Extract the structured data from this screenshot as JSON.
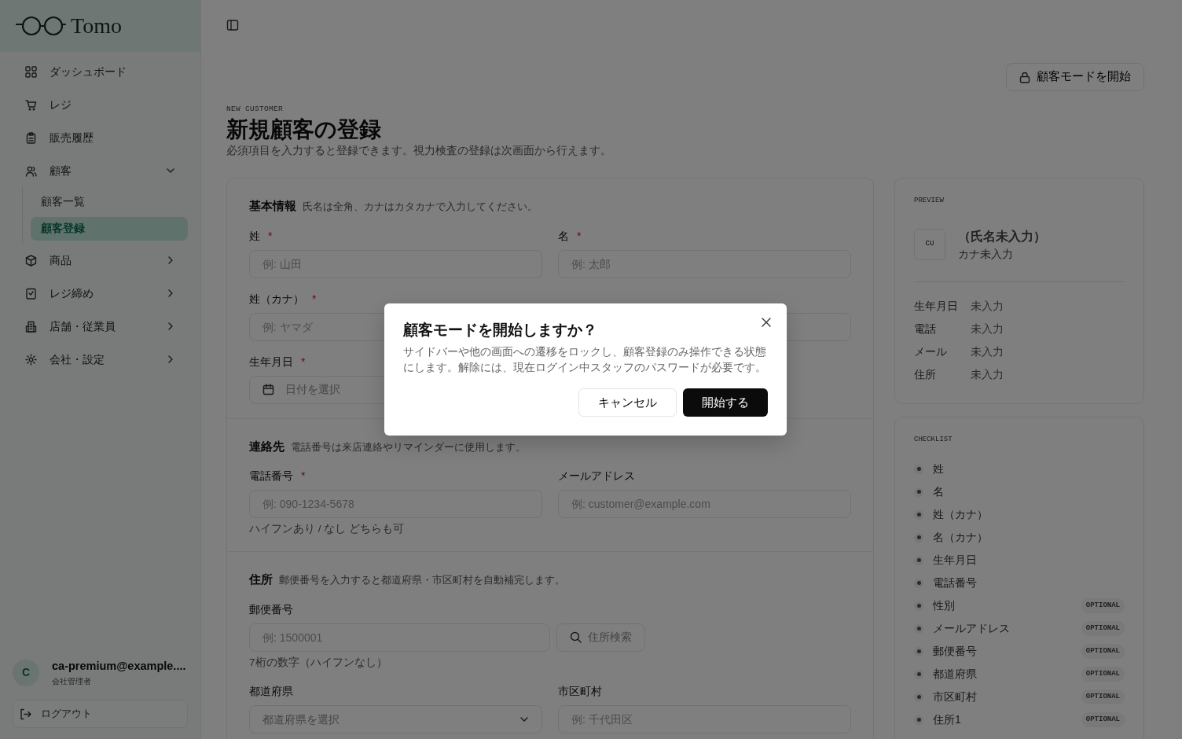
{
  "sidebar": {
    "logo": "Tomo",
    "nav": [
      {
        "label": "ダッシュボード"
      },
      {
        "label": "レジ"
      },
      {
        "label": "販売履歴"
      },
      {
        "label": "顧客",
        "expanded": true,
        "children": [
          {
            "label": "顧客一覧",
            "selected": false
          },
          {
            "label": "顧客登録",
            "selected": true
          }
        ]
      },
      {
        "label": "商品",
        "expanded": false
      },
      {
        "label": "レジ締め",
        "expanded": false
      },
      {
        "label": "店舗・従業員",
        "expanded": false
      },
      {
        "label": "会社・設定",
        "expanded": false
      }
    ],
    "user": {
      "initial": "C",
      "email": "ca-premium@example....",
      "role": "会社管理者"
    },
    "logout": "ログアウト"
  },
  "topbar": {
    "customer_mode_button": "顧客モードを開始"
  },
  "header": {
    "eyebrow": "NEW CUSTOMER",
    "title": "新規顧客の登録",
    "subtitle": "必須項目を入力すると登録できます。視力検査の登録は次画面から行えます。"
  },
  "form": {
    "required_mark": "*",
    "sections": [
      {
        "title": "基本情報",
        "hint": "氏名は全角、カナはカタカナで入力してください。",
        "fields": [
          {
            "kind": "text",
            "label": "姓",
            "required": true,
            "placeholder": "例: 山田"
          },
          {
            "kind": "text",
            "label": "名",
            "required": true,
            "placeholder": "例: 太郎"
          },
          {
            "kind": "text",
            "label": "姓（カナ）",
            "required": true,
            "placeholder": "例: ヤマダ"
          },
          {
            "kind": "text"
          },
          {
            "kind": "date",
            "label": "生年月日",
            "required": true,
            "placeholder": "日付を選択"
          }
        ]
      },
      {
        "title": "連絡先",
        "hint": "電話番号は来店連絡やリマインダーに使用します。",
        "fields": [
          {
            "kind": "text",
            "label": "電話番号",
            "required": true,
            "placeholder": "例: 090-1234-5678",
            "help": "ハイフンあり / なし どちらも可"
          },
          {
            "kind": "text",
            "label": "メールアドレス",
            "required": false,
            "placeholder": "例: customer@example.com"
          }
        ]
      },
      {
        "title": "住所",
        "hint": "郵便番号を入力すると都道府県・市区町村を自動補完します。",
        "fields": [
          {
            "kind": "postal",
            "label": "郵便番号",
            "required": false,
            "placeholder": "例: 1500001",
            "button": "住所検索",
            "help": "7桁の数字（ハイフンなし）"
          },
          {
            "kind": "select",
            "label": "都道府県",
            "required": false,
            "placeholder": "都道府県を選択"
          },
          {
            "kind": "text",
            "label": "市区町村",
            "required": false,
            "placeholder": "例: 千代田区"
          }
        ]
      }
    ]
  },
  "preview": {
    "label": "PREVIEW",
    "avatar": "CU",
    "name": "（氏名未入力）",
    "kana": "カナ未入力",
    "rows": [
      {
        "label": "生年月日",
        "value": "未入力"
      },
      {
        "label": "電話",
        "value": "未入力"
      },
      {
        "label": "メール",
        "value": "未入力"
      },
      {
        "label": "住所",
        "value": "未入力"
      }
    ]
  },
  "checklist": {
    "label": "CHECKLIST",
    "items": [
      {
        "label": "姓"
      },
      {
        "label": "名"
      },
      {
        "label": "姓（カナ）"
      },
      {
        "label": "名（カナ）"
      },
      {
        "label": "生年月日"
      },
      {
        "label": "電話番号"
      },
      {
        "label": "性別",
        "badge": "OPTIONAL"
      },
      {
        "label": "メールアドレス",
        "badge": "OPTIONAL"
      },
      {
        "label": "郵便番号",
        "badge": "OPTIONAL"
      },
      {
        "label": "都道府県",
        "badge": "OPTIONAL"
      },
      {
        "label": "市区町村",
        "badge": "OPTIONAL"
      },
      {
        "label": "住所1",
        "badge": "OPTIONAL"
      }
    ]
  },
  "dialog": {
    "title": "顧客モードを開始しますか？",
    "description": "サイドバーや他の画面への遷移をロックし、顧客登録のみ操作できる状態にします。解除には、現在ログイン中スタッフのパスワードが必要です。",
    "cancel": "キャンセル",
    "confirm": "開始する"
  }
}
